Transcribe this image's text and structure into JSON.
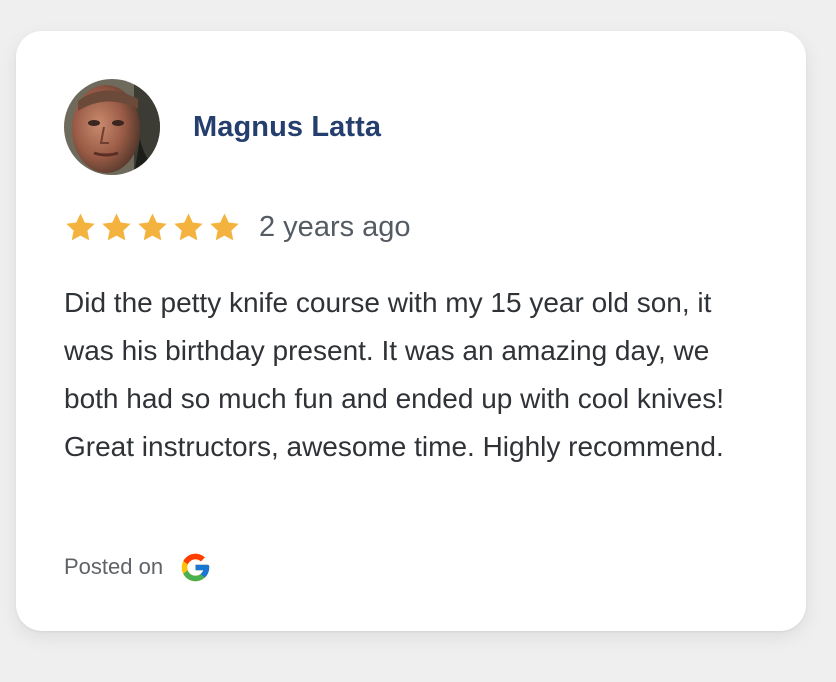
{
  "review": {
    "author": "Magnus Latta",
    "rating": 5,
    "rating_max": 5,
    "time_ago": "2 years ago",
    "text": "Did the petty knife course with my 15 year old son, it was his birthday present. It was an amazing day, we both had so much fun and ended up with cool knives! Great instructors, awesome time. Highly recommend.",
    "posted_on_label": "Posted on",
    "source_icon": "google-icon"
  },
  "colors": {
    "author_name": "#243e6e",
    "star": "#f4b33f",
    "background": "#efefef",
    "card": "#ffffff"
  }
}
